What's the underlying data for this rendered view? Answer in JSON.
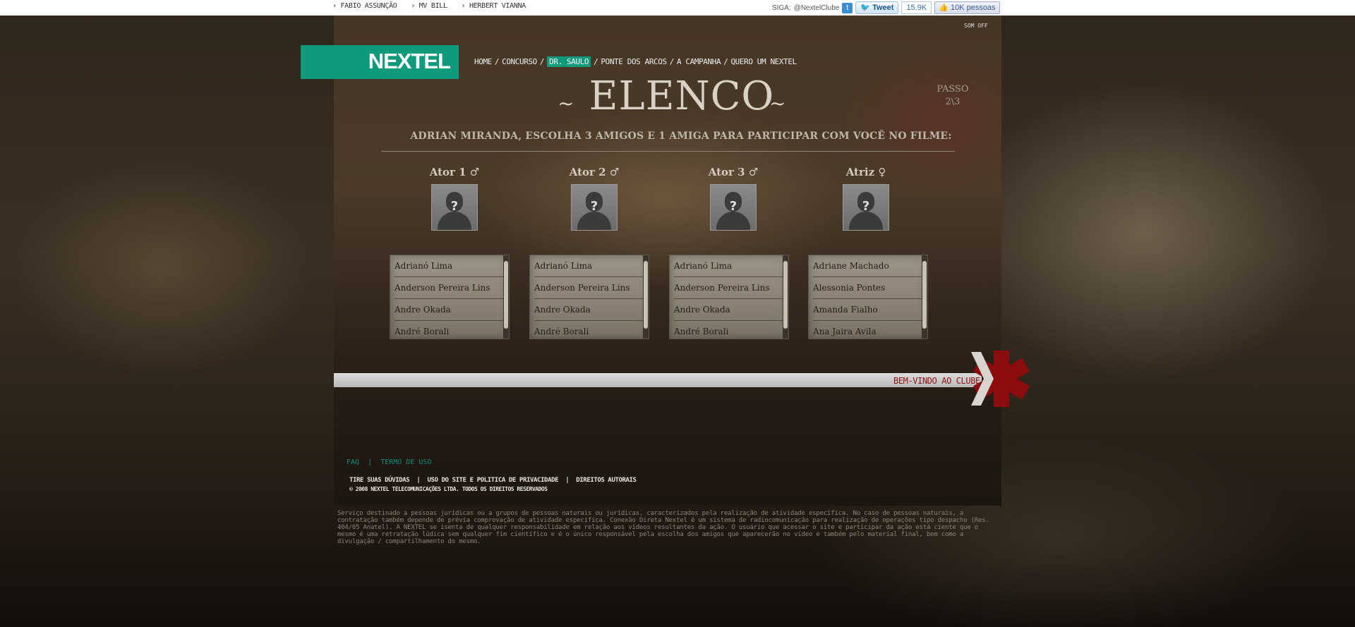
{
  "top_links": [
    "› FABIO ASSUNÇÃO",
    "› MV BILL",
    "› HERBERT VIANNA"
  ],
  "social": {
    "siga_label": "SIGA:",
    "handle": "@NextelClube",
    "tweet_label": "Tweet",
    "tweet_count": "15.9K",
    "like_label": "10K pessoas"
  },
  "som_off": "SOM OFF",
  "logo_text": "NEXTEL",
  "nav": {
    "items": [
      "HOME",
      "CONCURSO",
      "DR. SAULO",
      "PONTE DOS ARCOS",
      "A CAMPANHA",
      "QUERO UM NEXTEL"
    ],
    "active": "DR. SAULO"
  },
  "title": "ELENCO",
  "swash_left": "~",
  "swash_right": "~",
  "passo": {
    "label": "PASSO",
    "value": "2\\3"
  },
  "subtitle": "ADRIAN MIRANDA, ESCOLHA 3 AMIGOS E 1 AMIGA PARA PARTICIPAR COM VOCÊ NO FILME:",
  "slots": [
    {
      "label": "Ator 1 ♂",
      "placeholder": "?",
      "options": [
        "Adrianó Lima",
        "Anderson Pereira Lins",
        "Andre Okada",
        "André Borali"
      ]
    },
    {
      "label": "Ator 2 ♂",
      "placeholder": "?",
      "options": [
        "Adrianó Lima",
        "Anderson Pereira Lins",
        "Andre Okada",
        "André Borali"
      ]
    },
    {
      "label": "Ator 3 ♂",
      "placeholder": "?",
      "options": [
        "Adrianó Lima",
        "Anderson Pereira Lins",
        "Andre Okada",
        "André Borali"
      ]
    },
    {
      "label": "Atriz ♀",
      "placeholder": "?",
      "options": [
        "Adriane Machado",
        "Alessonia Pontes",
        "Amanda Fialho",
        "Ana Jaira Avila"
      ]
    }
  ],
  "welcome": "BEM-VINDO AO CLUBE",
  "footer": {
    "faq": "FAQ",
    "termo": "TERMO DE USO",
    "duvidas": "TIRE SUAS DÚVIDAS",
    "politica": "USO DO SITE E POLITICA DE PRIVACIDADE",
    "direitos": "DIREITOS AUTORAIS",
    "copyright": "© 2008 NEXTEL TELECOMUNICAÇÕES LTDA. TODOS OS DIREITOS RESERVADOS",
    "disclaimer": "Serviço destinado a pessoas jurídicas ou a grupos de pessoas naturais ou jurídicas, caracterizados pela realização de atividade específica. No caso de pessoas naturais, a contratação também depende de prévia comprovação de atividade específica. Conexão Direta Nextel é um sistema de radiocomunicação para realização de operações tipo despacho (Res. 404/05 Anatel). A NEXTEL se isenta de qualquer responsabilidade em relação aos vídeos resultantes da ação. O usuário que acessar o site e participar da ação está ciente que o mesmo é uma retratação lúdica sem qualquer fim científico e é o único responsável pela escolha dos amigos que aparecerão no vídeo e também pelo material final, bem como a divulgação / compartilhamento do mesmo."
  },
  "colors": {
    "brand": "#0f9a7c",
    "welcome_text": "#8e1414",
    "club_mark": "#8b0c0c"
  }
}
